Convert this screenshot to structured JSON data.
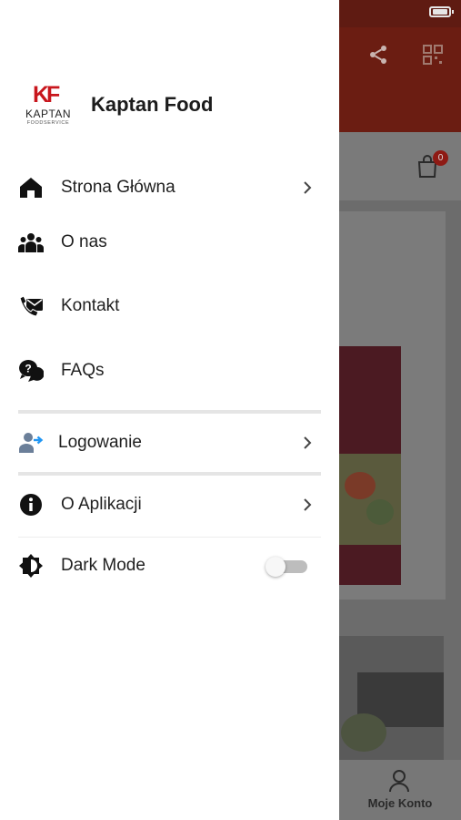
{
  "background_app": {
    "cart_count": "0",
    "bottom_nav_label": "Moje Konto"
  },
  "drawer": {
    "brand": {
      "logo_mark": "KF",
      "logo_word": "KAPTAN",
      "logo_sub": "FOODSERVICE",
      "name": "Kaptan Food"
    },
    "items": [
      {
        "label": "Strona Główna",
        "icon": "home-icon",
        "chevron": true
      },
      {
        "label": "O nas",
        "icon": "users-icon",
        "chevron": false
      },
      {
        "label": "Kontakt",
        "icon": "contact-icon",
        "chevron": false
      },
      {
        "label": "FAQs",
        "icon": "faq-icon",
        "chevron": false
      }
    ],
    "login": {
      "label": "Logowanie",
      "icon": "user-login-icon"
    },
    "about": {
      "label": "O Aplikacji",
      "icon": "info-icon"
    },
    "dark_mode": {
      "label": "Dark Mode",
      "icon": "brightness-icon",
      "enabled": false
    }
  },
  "colors": {
    "brand_red": "#c8161d",
    "text": "#1f1f1f",
    "divider": "#e5e5e5",
    "overlay_bg": "#6c6c6c"
  }
}
